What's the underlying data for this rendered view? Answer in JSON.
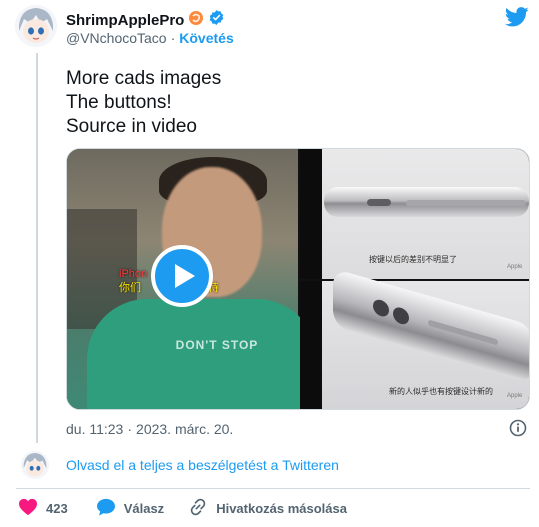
{
  "author": {
    "display_name": "ShrimpApplePro",
    "handle": "@VNchocoTaco",
    "separator": "·",
    "follow_label": "Követés"
  },
  "tweet": {
    "lines": [
      "More cads images",
      "The buttons!",
      "Source in video"
    ]
  },
  "media": {
    "video_caption_line1_red": "iPhon",
    "video_caption_line1": "样子",
    "video_caption_line2_a": "你们",
    "video_caption_line2_b": "等待",
    "video_shirt_text": "DON'T STOP",
    "image_top_caption": "按键以后的差别不明显了",
    "image_bottom_caption": "新的人似乎也有按键设计新的",
    "watermark": "Apple"
  },
  "meta": {
    "time": "du. 11:23",
    "separator": "·",
    "date": "2023. márc. 20."
  },
  "thread_link": "Olvasd el a teljes a beszélgetést a Twitteren",
  "actions": {
    "like_count": "423",
    "reply_label": "Válasz",
    "copy_label": "Hivatkozás másolása"
  },
  "colors": {
    "accent": "#1d9bf0",
    "like": "#f91880",
    "text": "#0f1419",
    "muted": "#536471"
  }
}
